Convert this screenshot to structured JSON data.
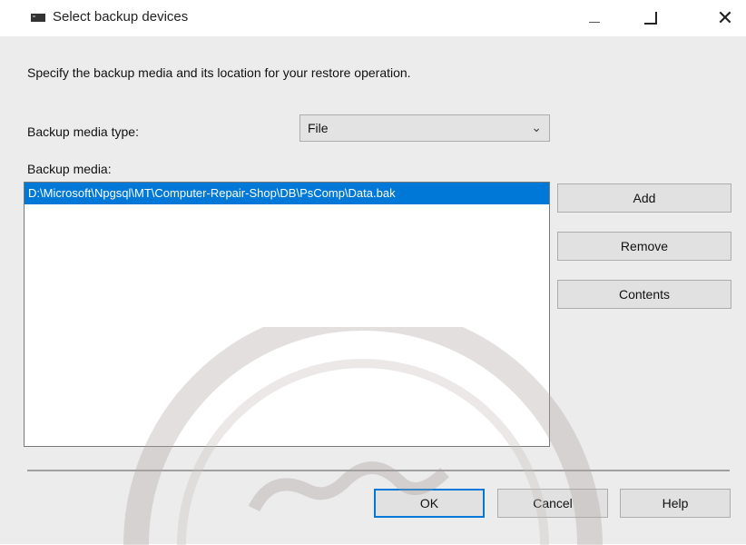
{
  "window": {
    "title": "Select backup devices",
    "icon": "drive-icon",
    "controls": {
      "minimize": "minimize-icon",
      "maximize": "maximize-icon",
      "close": "✕"
    }
  },
  "instruction": "Specify the backup media and its location for your restore operation.",
  "media_type": {
    "label": "Backup media type:",
    "selected": "File"
  },
  "media": {
    "label": "Backup media:",
    "items": [
      "D:\\Microsoft\\Npgsql\\MT\\Computer-Repair-Shop\\DB\\PsComp\\Data.bak"
    ]
  },
  "side_buttons": {
    "add": "Add",
    "remove": "Remove",
    "contents": "Contents"
  },
  "footer_buttons": {
    "ok": "OK",
    "cancel": "Cancel",
    "help": "Help"
  }
}
